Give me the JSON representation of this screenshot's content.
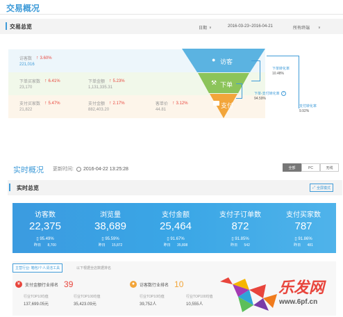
{
  "top": {
    "title": "交易概况",
    "panel_title": "交易总览",
    "date_label": "日期",
    "date_range": "2016-03-23~2016-04-21",
    "terminal": "所有终端",
    "rows": [
      {
        "cols": [
          {
            "label": "访客数",
            "change": "3.60%",
            "value": "221,016"
          }
        ]
      },
      {
        "cols": [
          {
            "label": "下单买家数",
            "change": "6.41%",
            "value": "23,170"
          },
          {
            "label": "下单金额",
            "change": "5.23%",
            "value": "1,131,335.31"
          }
        ]
      },
      {
        "cols": [
          {
            "label": "支付买家数",
            "change": "5.47%",
            "value": "21,822"
          },
          {
            "label": "支付金额",
            "change": "2.17%",
            "value": "882,403.20"
          },
          {
            "label": "客单价",
            "change": "3.12%",
            "value": "44.81"
          }
        ]
      }
    ],
    "funnel": {
      "visit": "访客",
      "order": "下单",
      "pay": "支付",
      "order_rate_label": "下单转化率",
      "order_rate": "10.48%",
      "order_pay_label": "下单-支付转化率",
      "order_pay": "94.59%",
      "pay_rate_label": "支付转化率",
      "pay_rate": "9.92%"
    }
  },
  "realtime": {
    "title": "实时概况",
    "update_label": "更新时间:",
    "update_time": "2016-04-22 13:25:28",
    "tabs": [
      "全部",
      "PC",
      "无线"
    ],
    "panel_title": "实时总览",
    "fullscreen": "全屏模式",
    "cards": [
      {
        "label": "访客数",
        "value": "22,375",
        "pct": "95.49%",
        "yest": "昨日",
        "yval": "8,700"
      },
      {
        "label": "浏览量",
        "value": "38,689",
        "pct": "95.59%",
        "yest": "昨日",
        "yval": "15,872"
      },
      {
        "label": "支付金额",
        "value": "25,464",
        "pct": "91.67%",
        "yest": "昨日",
        "yval": "35,808"
      },
      {
        "label": "支付子订单数",
        "value": "872",
        "pct": "91.85%",
        "yest": "昨日",
        "yval": "542"
      },
      {
        "label": "支付买家数",
        "value": "787",
        "pct": "91.86%",
        "yest": "昨日",
        "yval": "481"
      }
    ],
    "industry_tag": "主营行业: 箱包/个人清洁工具",
    "industry_note": "以下根据全店数据排名",
    "rank1": {
      "label": "支付金额行业排名",
      "rank": "39",
      "c1": "行业TOP10均值",
      "v1": "137,699.05元",
      "c2": "行业TOP100均值",
      "v2": "35,423.09元"
    },
    "rank2": {
      "label": "访客数行业排名",
      "rank": "10",
      "c1": "行业TOP10均值",
      "v1": "39,752人",
      "c2": "行业TOP100均值",
      "v2": "10,555人"
    },
    "watermark_text": "乐发网",
    "watermark_url": "www.6pf.cn"
  }
}
